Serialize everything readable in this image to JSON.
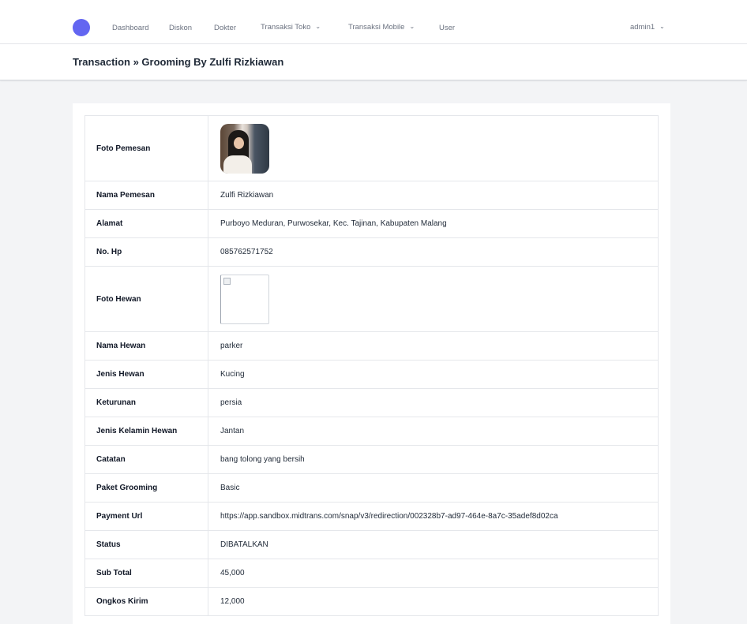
{
  "nav": {
    "links": [
      "Dashboard",
      "Diskon",
      "Dokter",
      "Transaksi Toko",
      "Transaksi Mobile",
      "User"
    ],
    "user": "admin1",
    "logo_icon": "planet-logo-icon",
    "dropdown_icon": "chevron-down-icon"
  },
  "header": {
    "title": "Transaction » Grooming By Zulfi Rizkiawan"
  },
  "details": {
    "foto_pemesan_label": "Foto Pemesan",
    "nama_pemesan_label": "Nama Pemesan",
    "nama_pemesan": "Zulfi Rizkiawan",
    "alamat_label": "Alamat",
    "alamat": "Purboyo Meduran, Purwosekar, Kec. Tajinan, Kabupaten Malang",
    "no_hp_label": "No. Hp",
    "no_hp": "085762571752",
    "foto_hewan_label": "Foto Hewan",
    "nama_hewan_label": "Nama Hewan",
    "nama_hewan": "parker",
    "jenis_hewan_label": "Jenis Hewan",
    "jenis_hewan": "Kucing",
    "keturunan_label": "Keturunan",
    "keturunan": "persia",
    "jenis_kelamin_label": "Jenis Kelamin Hewan",
    "jenis_kelamin": "Jantan",
    "catatan_label": "Catatan",
    "catatan": "bang tolong yang bersih",
    "paket_label": "Paket Grooming",
    "paket": "Basic",
    "payment_url_label": "Payment Url",
    "payment_url": "https://app.sandbox.midtrans.com/snap/v3/redirection/002328b7-ad97-464e-8a7c-35adef8d02ca",
    "status_label": "Status",
    "status": "DIBATALKAN",
    "sub_total_label": "Sub Total",
    "sub_total": "45,000",
    "ongkos_label": "Ongkos Kirim",
    "ongkos": "12,000"
  },
  "colors": {
    "accent": "#6366f1",
    "background": "#f3f4f6"
  }
}
